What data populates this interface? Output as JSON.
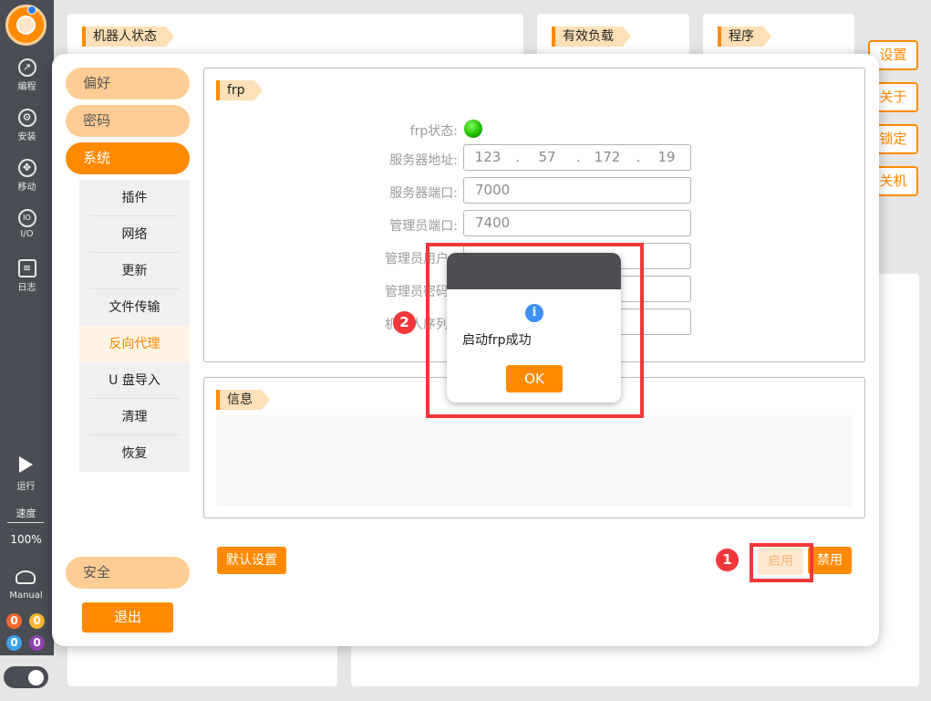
{
  "sidebar": {
    "nav": [
      {
        "label": "编程",
        "icon": "programming-icon"
      },
      {
        "label": "安装",
        "icon": "install-icon"
      },
      {
        "label": "移动",
        "icon": "move-icon"
      },
      {
        "label": "I/O",
        "icon": "io-icon"
      },
      {
        "label": "日志",
        "icon": "log-icon"
      }
    ],
    "run_label": "运行",
    "speed_label": "速度",
    "speed_value": "100%",
    "mode_label": "Manual",
    "counters": [
      "0",
      "0",
      "0",
      "0"
    ],
    "counter_colors": [
      "#f26a2e",
      "#f7b731",
      "#3ea0e8",
      "#8e44ad"
    ]
  },
  "background": {
    "cards": [
      "机器人状态",
      "有效负载",
      "程序"
    ],
    "side_buttons": [
      "设置",
      "关于",
      "锁定",
      "关机"
    ]
  },
  "settings": {
    "menu": {
      "preference": "偏好",
      "password": "密码",
      "system": "系统",
      "security": "安全",
      "exit": "退出"
    },
    "system_items": [
      "插件",
      "网络",
      "更新",
      "文件传输",
      "反向代理",
      "U 盘导入",
      "清理",
      "恢复"
    ],
    "active_item": "反向代理",
    "frp": {
      "title": "frp",
      "status_label": "frp状态:",
      "server_address_label": "服务器地址:",
      "server_ip": [
        "123",
        "57",
        "172",
        "19"
      ],
      "server_port_label": "服务器端口:",
      "server_port": "7000",
      "admin_port_label": "管理员端口:",
      "admin_port": "7400",
      "admin_user_label": "管理员用户",
      "admin_password_label": "管理员密码",
      "serial_label": "机器人序列号"
    },
    "info": {
      "title": "信息"
    },
    "buttons": {
      "default": "默认设置",
      "enable": "启用",
      "disable": "禁用"
    }
  },
  "dialog": {
    "message": "启动frp成功",
    "ok": "OK"
  },
  "annotations": {
    "step1": "1",
    "step2": "2"
  },
  "colors": {
    "accent": "#ff8a00",
    "highlight": "#f2373b",
    "status_on": "#23c000"
  }
}
